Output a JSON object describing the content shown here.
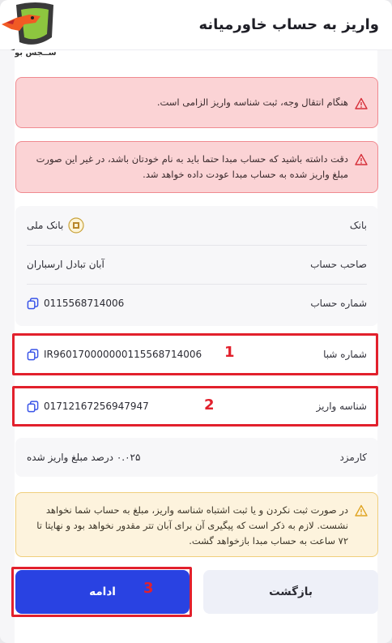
{
  "header": {
    "title": "واریز به حساب خاورمیانه"
  },
  "logo": {
    "text": "ســجس بوکر"
  },
  "alerts": [
    {
      "text": "هنگام انتقال وجه، ثبت شناسه واریز الزامی است."
    },
    {
      "text": "دقت داشته باشید که حساب مبدا حتما باید به نام خودتان باشد، در غیر این صورت مبلغ واریز شده به حساب مبدا عودت داده خواهد شد."
    }
  ],
  "account": {
    "bank_label": "بانک",
    "bank_value": "بانک ملی",
    "owner_label": "صاحب حساب",
    "owner_value": "آبان تبادل ارسباران",
    "number_label": "شماره حساب",
    "number_value": "0115568714006",
    "sheba_label": "شماره شبا",
    "sheba_value": "IR960170000000115568714006",
    "deposit_id_label": "شناسه واریز",
    "deposit_id_value": "01712167256947947",
    "fee_label": "کارمزد",
    "fee_value": "۰.۰۲۵ درصد مبلغ واریز شده"
  },
  "warning": {
    "text": "در صورت ثبت نکردن و یا ثبت اشتباه شناسه واریز، مبلغ به حساب شما نخواهد نشست. لازم به ذکر است که پیگیری آن برای آبان تتر مقدور نخواهد بود و نهایتا تا ۷۲ ساعت به حساب مبدا بازخواهد گشت."
  },
  "buttons": {
    "back": "بازگشت",
    "continue": "ادامه"
  },
  "annotations": [
    "1",
    "2",
    "3"
  ],
  "colors": {
    "primary": "#2942e2",
    "alert_bg": "#fbd3d5",
    "alert_border": "#f08a90",
    "warning_bg": "#fdf3dd",
    "highlight": "#e2202c"
  }
}
